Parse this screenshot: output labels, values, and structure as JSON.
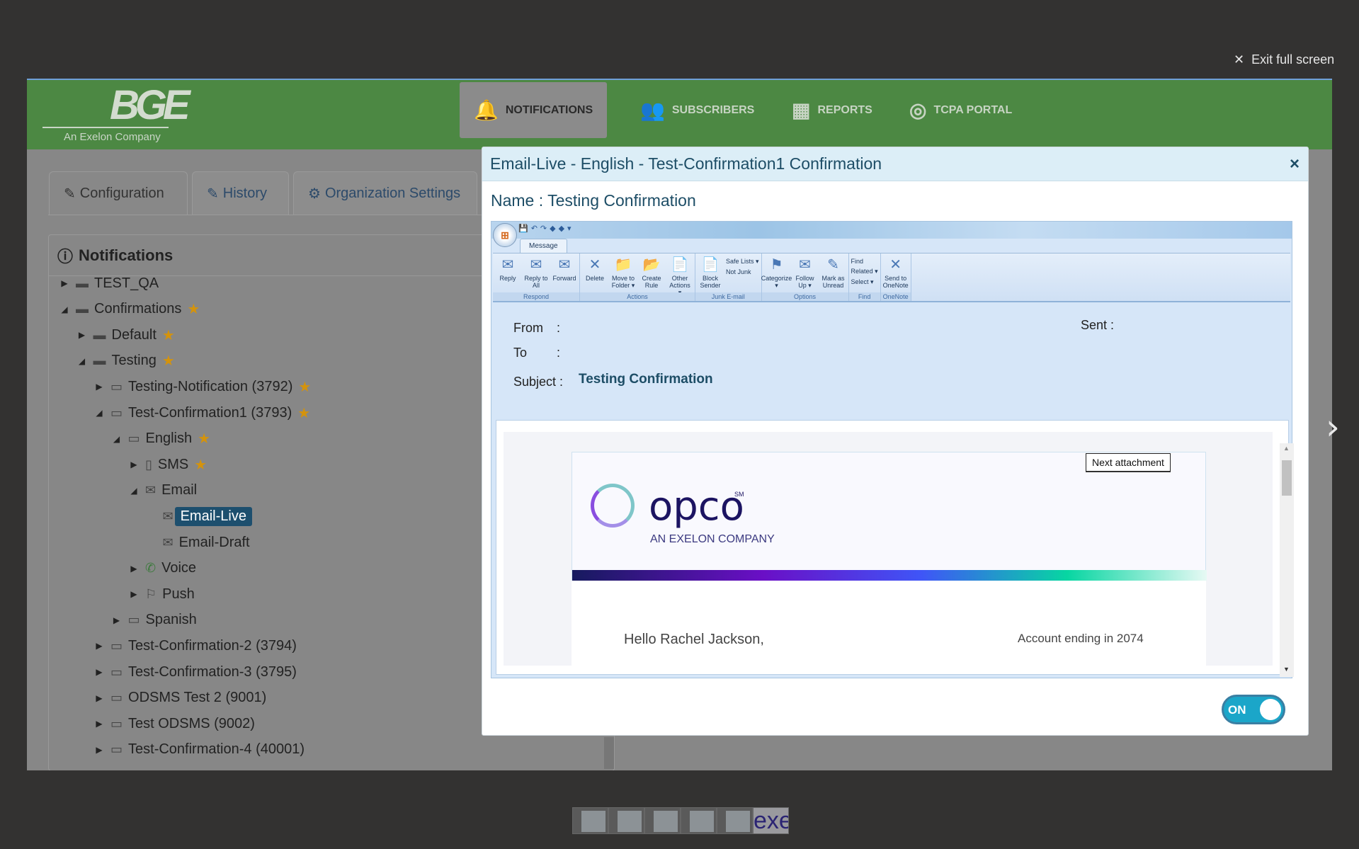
{
  "exit_fullscreen": "Exit full screen",
  "app": {
    "logo": {
      "brand": "BGE",
      "tagline": "An Exelon Company"
    },
    "nav": [
      {
        "label": "NOTIFICATIONS",
        "icon": "bell-icon",
        "active": true
      },
      {
        "label": "SUBSCRIBERS",
        "icon": "users-icon"
      },
      {
        "label": "REPORTS",
        "icon": "table-icon"
      },
      {
        "label": "TCPA PORTAL",
        "icon": "target-icon"
      }
    ],
    "tabs": [
      {
        "label": "Configuration",
        "icon": "edit-icon"
      },
      {
        "label": "History",
        "icon": "edit-icon"
      },
      {
        "label": "Organization Settings",
        "icon": "gears-icon"
      }
    ],
    "panel_title": "Notifications",
    "tree": [
      {
        "level": 0,
        "label": "TEST_QA",
        "arrow": "collapsed",
        "icon": "folder",
        "star": false
      },
      {
        "level": 0,
        "label": "Confirmations",
        "arrow": "expanded",
        "icon": "folder",
        "star": true
      },
      {
        "level": 1,
        "label": "Default",
        "arrow": "collapsed",
        "icon": "folder",
        "star": true
      },
      {
        "level": 1,
        "label": "Testing",
        "arrow": "expanded",
        "icon": "folder",
        "star": true
      },
      {
        "level": 2,
        "label": "Testing-Notification (3792)",
        "arrow": "collapsed",
        "icon": "folder-open",
        "star": true
      },
      {
        "level": 2,
        "label": "Test-Confirmation1 (3793)",
        "arrow": "expanded",
        "icon": "folder-open",
        "star": true
      },
      {
        "level": 3,
        "label": "English",
        "arrow": "expanded",
        "icon": "folder-open",
        "star": true
      },
      {
        "level": 4,
        "label": "SMS",
        "arrow": "collapsed",
        "icon": "mobile",
        "star": true
      },
      {
        "level": 4,
        "label": "Email",
        "arrow": "expanded",
        "icon": "envelope",
        "star": false
      },
      {
        "level": 5,
        "label": "Email-Live",
        "arrow": "none",
        "icon": "envelope",
        "star": false,
        "selected": true
      },
      {
        "level": 5,
        "label": "Email-Draft",
        "arrow": "none",
        "icon": "envelope",
        "star": false
      },
      {
        "level": 4,
        "label": "Voice",
        "arrow": "collapsed",
        "icon": "phone",
        "star": false
      },
      {
        "level": 4,
        "label": "Push",
        "arrow": "collapsed",
        "icon": "flag",
        "star": false
      },
      {
        "level": 3,
        "label": "Spanish",
        "arrow": "collapsed",
        "icon": "folder-open",
        "star": false
      },
      {
        "level": 2,
        "label": "Test-Confirmation-2 (3794)",
        "arrow": "collapsed",
        "icon": "folder-open",
        "star": false
      },
      {
        "level": 2,
        "label": "Test-Confirmation-3 (3795)",
        "arrow": "collapsed",
        "icon": "folder-open",
        "star": false
      },
      {
        "level": 2,
        "label": "ODSMS Test 2 (9001)",
        "arrow": "collapsed",
        "icon": "folder-open",
        "star": false
      },
      {
        "level": 2,
        "label": "Test ODSMS (9002)",
        "arrow": "collapsed",
        "icon": "folder-open",
        "star": false
      },
      {
        "level": 2,
        "label": "Test-Confirmation-4 (40001)",
        "arrow": "collapsed",
        "icon": "folder-open",
        "star": false
      }
    ]
  },
  "modal": {
    "title": "Email-Live - English - Test-Confirmation1 Confirmation",
    "close": "×",
    "name_line": "Name : Testing Confirmation",
    "outlook": {
      "tab": "Message",
      "groups": [
        {
          "label": "Respond",
          "buttons": [
            "Reply",
            "Reply to All",
            "Forward"
          ],
          "small": []
        },
        {
          "label": "Actions",
          "buttons": [
            "Delete",
            "Move to Folder ▾",
            "Create Rule",
            "Other Actions ▾"
          ],
          "small": []
        },
        {
          "label": "Junk E-mail",
          "buttons": [
            "Block Sender"
          ],
          "small": [
            "Safe Lists ▾",
            "Not Junk"
          ]
        },
        {
          "label": "Options",
          "buttons": [
            "Categorize ▾",
            "Follow Up ▾",
            "Mark as Unread"
          ],
          "small": []
        },
        {
          "label": "Find",
          "buttons": [],
          "small": [
            "Find",
            "Related ▾",
            "Select ▾"
          ]
        },
        {
          "label": "OneNote",
          "buttons": [
            "Send to OneNote"
          ],
          "small": []
        }
      ],
      "from_label": "From",
      "to_label": "To",
      "subject_label": "Subject :",
      "colon": ":",
      "sent_label": "Sent :",
      "subject": "Testing Confirmation"
    },
    "email": {
      "brand": "opco",
      "sm": "SM",
      "tagline": "AN EXELON COMPANY",
      "next_attachment": "Next attachment",
      "greeting": "Hello Rachel Jackson,",
      "account": "Account ending in 2074"
    },
    "toggle": {
      "label": "ON",
      "on": true
    }
  },
  "thumbnails": {
    "count": 6,
    "last_text": "exe"
  }
}
